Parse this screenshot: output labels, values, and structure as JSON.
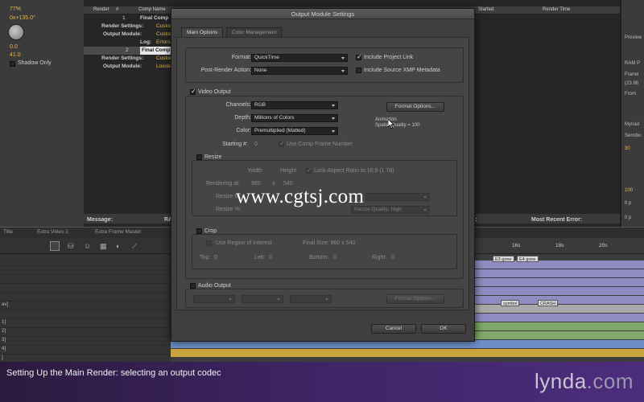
{
  "background": {
    "left_panel": {
      "zoom": "77%",
      "rotation": "0x+135.0°",
      "value1": "0.0",
      "value2": "41.0",
      "shadow_only": "Shadow Only"
    },
    "render_queue": {
      "columns": [
        "Render",
        "#",
        "Comp Name",
        "Started",
        "Render Time"
      ],
      "rows": [
        {
          "num": "1",
          "name": "Final Comp"
        },
        {
          "label": "Render Settings:",
          "value": "Custom"
        },
        {
          "label": "Output Module:",
          "value": "Custom"
        },
        {
          "label": "Log:",
          "value": "Errors"
        },
        {
          "num": "2",
          "name": "Final Comp"
        },
        {
          "label": "Render Settings:",
          "value": "Custom"
        },
        {
          "label": "Output Module:",
          "value": "Lossless"
        }
      ],
      "message_label": "Message:",
      "ram_label": "RA",
      "recent_error_label": "Most Recent Error:",
      "d_label": "d:"
    },
    "right_panel": [
      "Preview",
      "RAM P",
      "Frame",
      "(23.98",
      "From",
      "Myriad",
      "Semibo",
      "30",
      "100",
      "0 p",
      "0 p"
    ],
    "timeline": {
      "tabs": [
        "Title",
        "Extra Video 1",
        "Extra Frame Master"
      ],
      "ruler": [
        "16s",
        "18s",
        "20s"
      ],
      "markers": [
        "E3 gone",
        "E4 gone",
        "symbol",
        "CRASH"
      ],
      "layer_labels": [
        "av]",
        "1]",
        "2]",
        "3]",
        "4]",
        "]"
      ]
    }
  },
  "dialog": {
    "title": "Output Module Settings",
    "tabs": [
      "Main Options",
      "Color Management"
    ],
    "format_label": "Format:",
    "format_value": "QuickTime",
    "post_render_label": "Post-Render Action:",
    "post_render_value": "None",
    "include_project_link": "Include Project Link",
    "include_xmp": "Include Source XMP Metadata",
    "video_output": "Video Output",
    "channels_label": "Channels:",
    "channels_value": "RGB",
    "depth_label": "Depth:",
    "depth_value": "Millions of Colors",
    "color_label": "Color:",
    "color_value": "Premultiplied (Matted)",
    "format_options_button": "Format Options...",
    "codec_info_line1": "Animation",
    "codec_info_line2": "Spatial Quality = 100",
    "starting_label": "Starting #:",
    "starting_value": "0",
    "use_comp_frame": "Use Comp Frame Number",
    "resize": "Resize",
    "width_col": "Width",
    "height_col": "Height",
    "lock_aspect": "Lock Aspect Ratio to 16:9 (1.78)",
    "rendering_at_label": "Rendering at:",
    "rendering_w": "960",
    "x": "x",
    "rendering_h": "540",
    "resize_to_label": "Resize to:",
    "resize_pct_label": "Resize %:",
    "resize_quality": "Resize Quality: High",
    "crop": "Crop",
    "use_roi": "Use Region of Interest",
    "final_size": "Final Size: 960 x 540",
    "top_label": "Top:",
    "top_value": "0",
    "left_label": "Left:",
    "left_value": "0",
    "bottom_label": "Bottom:",
    "bottom_value": "0",
    "right_label": "Right:",
    "right_value": "0",
    "audio_output": "Audio Output",
    "audio_format_options": "Format Options...",
    "cancel": "Cancel",
    "ok": "OK"
  },
  "watermark": "www.cgtsj.com",
  "caption": "Setting Up the Main Render: selecting an output codec",
  "brand": {
    "name": "lynda",
    "suffix": ".com"
  }
}
